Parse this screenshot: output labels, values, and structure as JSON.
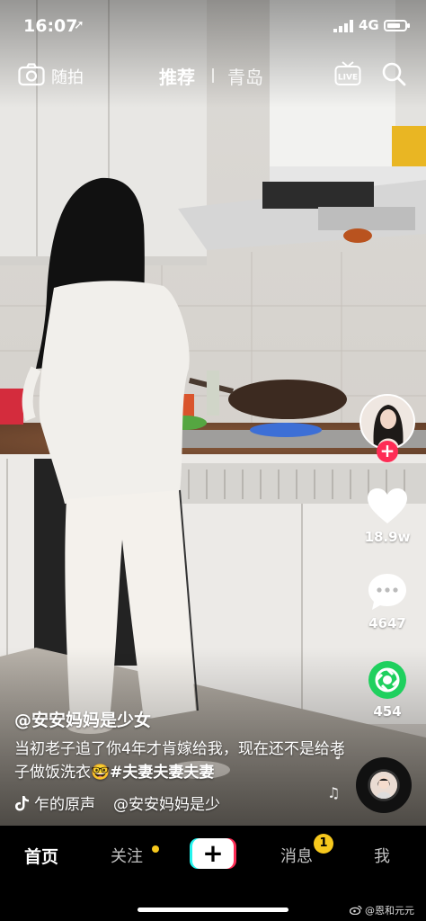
{
  "status_bar": {
    "time": "16:07",
    "location_arrow": "location-arrow-icon",
    "network": "4G",
    "battery_level": 0.8
  },
  "top_nav": {
    "camera_label": "随拍",
    "tab_recommended": "推荐",
    "tab_city": "青岛",
    "live_icon": "LIVE"
  },
  "rail": {
    "likes": "18.9w",
    "comments": "4647",
    "shares": "454"
  },
  "caption": {
    "author": "@安安妈妈是少女",
    "text": "当初老子追了你4年才肯嫁给我，现在还不是给老子做饭洗衣",
    "emoji": "🤓",
    "hashtag": "#夫妻夫妻夫妻"
  },
  "music": {
    "original_sound": "乍的原声",
    "author": "@安安妈妈是少"
  },
  "tab_bar": {
    "home": "首页",
    "follow": "关注",
    "create": "+",
    "messages": "消息",
    "messages_badge": "1",
    "me": "我"
  },
  "watermark": "@恩和元元",
  "colors": {
    "accent_red": "#fe2c55",
    "accent_cyan": "#25f4ee",
    "badge_yellow": "#f6c81d",
    "share_green": "#1fd05e"
  }
}
